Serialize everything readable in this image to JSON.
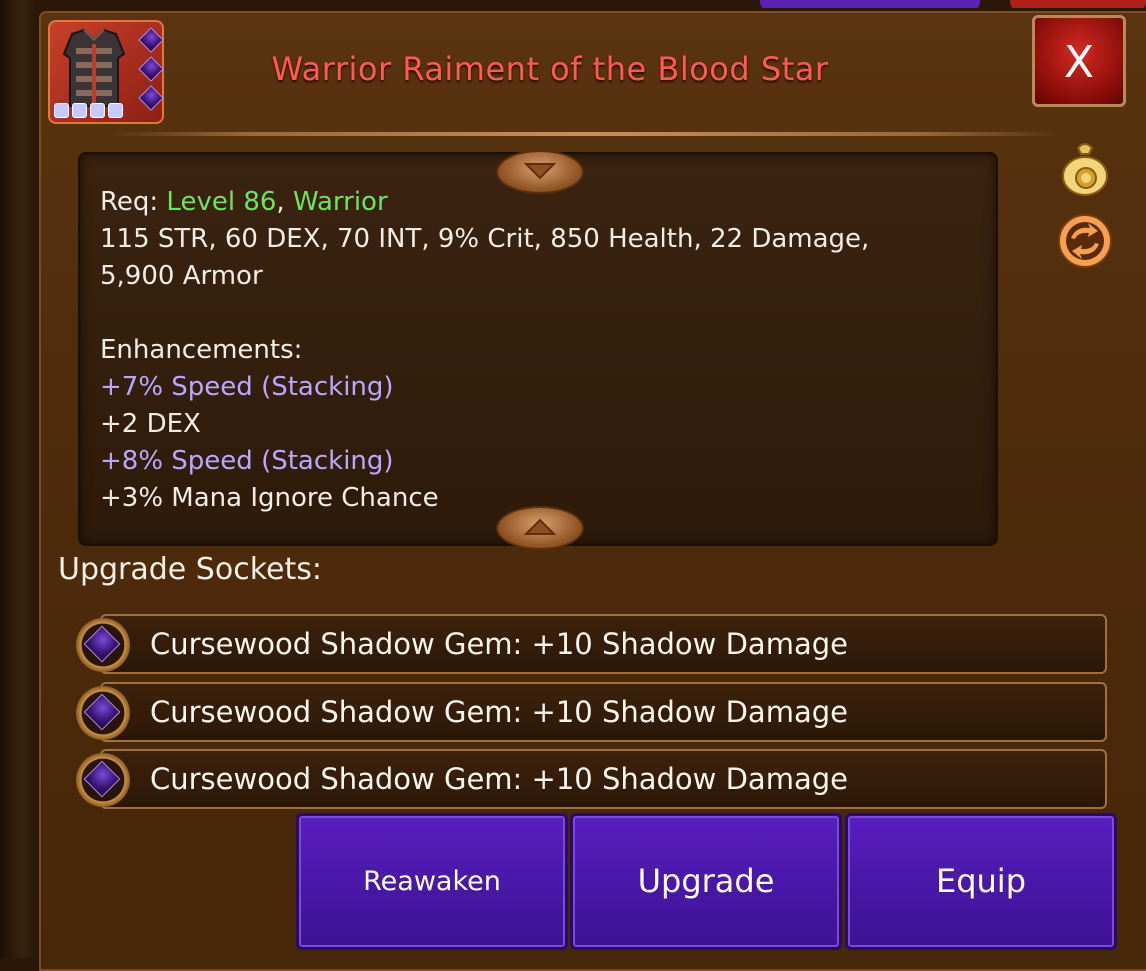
{
  "item": {
    "title": "Warrior Raiment of the Blood Star",
    "icon": "armor-vest-icon",
    "gem_slots": 3,
    "quality_pips": 4
  },
  "close": {
    "label": "X"
  },
  "requirements": {
    "prefix": "Req: ",
    "level": "Level 86",
    "separator": ", ",
    "class": "Warrior",
    "stats_line1": "115 STR, 60 DEX, 70 INT, 9% Crit, 850 Health, 22 Damage,",
    "stats_line2": "5,900 Armor"
  },
  "enhancements": {
    "heading": "Enhancements:",
    "items": [
      {
        "text": "+7% Speed (Stacking)",
        "color": "#b9a8ff"
      },
      {
        "text": "+2 DEX",
        "color": "#f0ece6"
      },
      {
        "text": "+8% Speed (Stacking)",
        "color": "#b9a8ff"
      },
      {
        "text": "+3% Mana Ignore Chance",
        "color": "#f0ece6"
      }
    ]
  },
  "side_icons": [
    "gold-bag-icon",
    "swap-arrows-icon"
  ],
  "sockets": {
    "heading": "Upgrade Sockets:",
    "items": [
      {
        "text": "Cursewood Shadow Gem: +10 Shadow Damage"
      },
      {
        "text": "Cursewood Shadow Gem: +10 Shadow Damage"
      },
      {
        "text": "Cursewood Shadow Gem: +10 Shadow Damage"
      }
    ]
  },
  "buttons": {
    "reawaken": "Reawaken",
    "upgrade": "Upgrade",
    "equip": "Equip"
  },
  "colors": {
    "title": "#ff5a55",
    "requirement_highlight": "#6ee45a",
    "speed_enhancement": "#b9a8ff",
    "button_purple": "#4a17a8",
    "close_red": "#c41e18"
  }
}
